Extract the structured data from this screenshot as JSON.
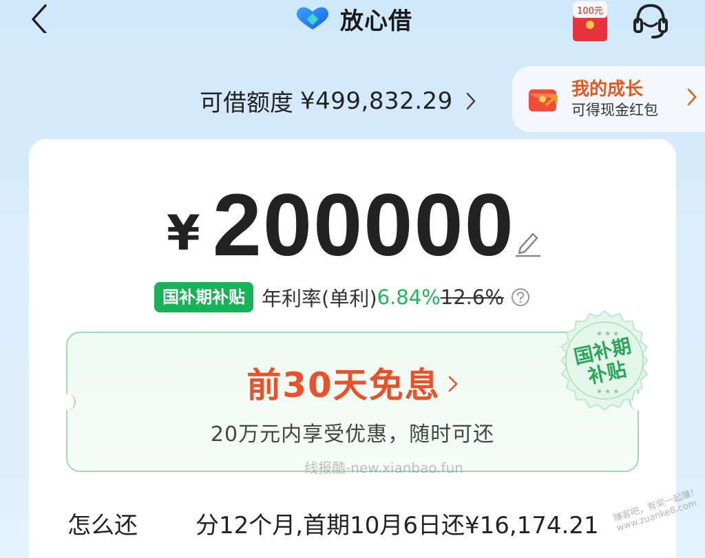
{
  "header": {
    "brand_name": "放心借",
    "redpacket_label": "100元"
  },
  "credit": {
    "label": "可借额度",
    "amount": "¥499,832.29"
  },
  "growth": {
    "title": "我的成长",
    "subtitle": "可得现金红包"
  },
  "loan": {
    "currency": "¥",
    "amount": "200000",
    "subsidy_tag": "国补期补贴",
    "rate_label": "年利率(单利)",
    "rate_value": "6.84%",
    "rate_old": "12.6%"
  },
  "promo": {
    "title": "前30天免息",
    "subtitle": "20万元内享受优惠，随时可还",
    "stamp_line1": "国补期",
    "stamp_line2": "补贴"
  },
  "repay": {
    "label": "怎么还",
    "value": "分12个月,首期10月6日还¥16,174.21"
  },
  "watermark": "线报酷-new.xianbao.fun",
  "corner_watermark": "赚客吧，有奖一起赚！www.zuanke8.com",
  "colors": {
    "accent_green": "#18b357",
    "promo_orange": "#e8512a",
    "growth_orange": "#e2581d"
  }
}
